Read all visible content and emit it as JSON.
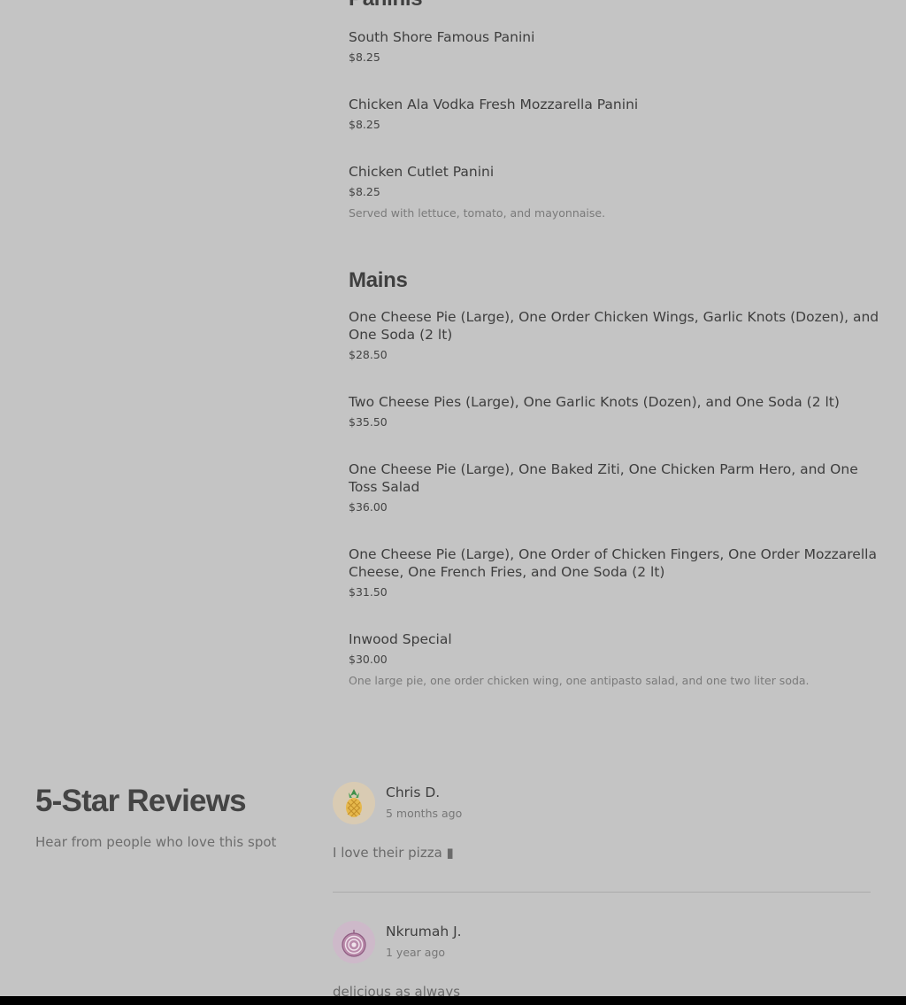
{
  "menu": {
    "sections": [
      {
        "title": "Paninis",
        "items": [
          {
            "name": "South Shore Famous Panini",
            "price": "$8.25",
            "description": ""
          },
          {
            "name": "Chicken Ala Vodka Fresh Mozzarella Panini",
            "price": "$8.25",
            "description": ""
          },
          {
            "name": "Chicken Cutlet Panini",
            "price": "$8.25",
            "description": "Served with lettuce, tomato, and mayonnaise."
          }
        ]
      },
      {
        "title": "Mains",
        "items": [
          {
            "name": "One Cheese Pie (Large), One Order Chicken Wings, Garlic Knots (Dozen), and One Soda (2 lt)",
            "price": "$28.50",
            "description": ""
          },
          {
            "name": "Two Cheese Pies (Large), One Garlic Knots (Dozen), and One Soda (2 lt)",
            "price": "$35.50",
            "description": ""
          },
          {
            "name": "One Cheese Pie (Large), One Baked Ziti, One Chicken Parm Hero, and One Toss Salad",
            "price": "$36.00",
            "description": ""
          },
          {
            "name": "One Cheese Pie (Large), One Order of Chicken Fingers, One Order Mozzarella Cheese, One French Fries, and One Soda (2 lt)",
            "price": "$31.50",
            "description": ""
          },
          {
            "name": "Inwood Special",
            "price": "$30.00",
            "description": "One large pie, one order chicken wing, one antipasto salad, and one two liter soda."
          }
        ]
      }
    ]
  },
  "reviews": {
    "heading": "5-Star Reviews",
    "subheading": "Hear from people who love this spot",
    "items": [
      {
        "name": "Chris D.",
        "time": "5 months ago",
        "text": "I love their pizza ▮",
        "avatar_icon": "pineapple-icon",
        "avatar_color": "#d9cbb3"
      },
      {
        "name": "Nkrumah J.",
        "time": "1 year ago",
        "text": "delicious as always",
        "avatar_icon": "onion-icon",
        "avatar_color": "#cdb9c9"
      }
    ]
  }
}
